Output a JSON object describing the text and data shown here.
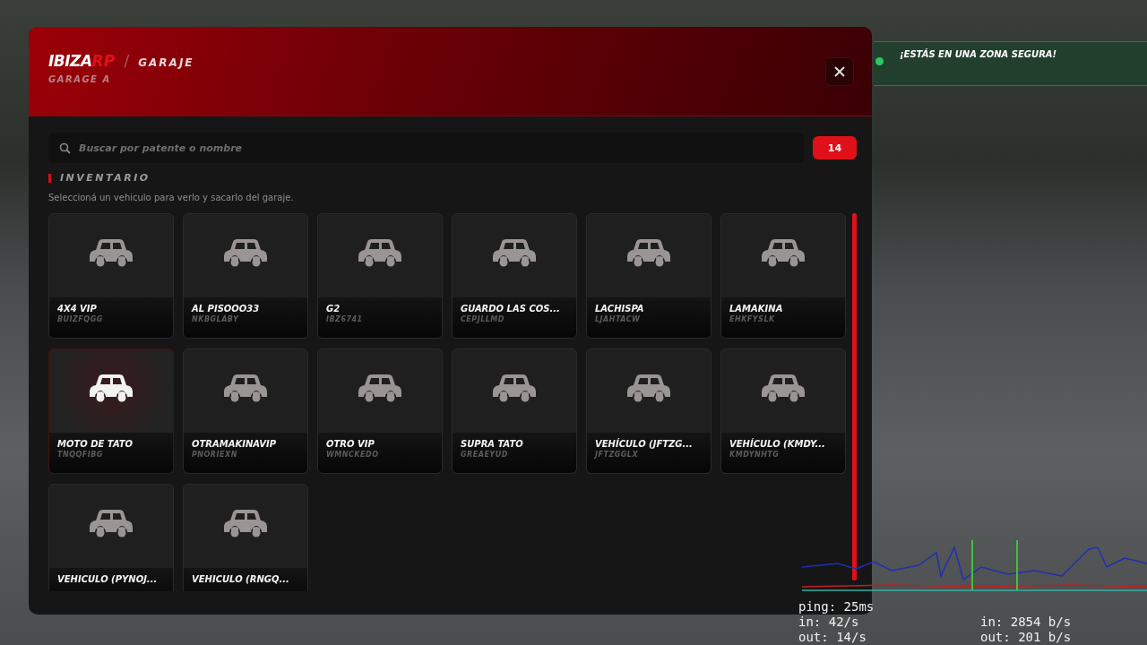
{
  "header": {
    "brand": "IBIZA",
    "brand_suffix": "RP",
    "separator": "/",
    "title": "GARAJE",
    "subtitle": "GARAGE A"
  },
  "search": {
    "placeholder": "Buscar por patente o nombre"
  },
  "count": "14",
  "section": {
    "title": "INVENTARIO",
    "hint": "Seleccioná un vehiculo para verlo y sacarlo del garaje."
  },
  "vehicles": [
    {
      "name": "4X4 VIP",
      "plate": "BUIZFQGG",
      "selected": false
    },
    {
      "name": "AL PISOOO33",
      "plate": "NKBGLABY",
      "selected": false
    },
    {
      "name": "G2",
      "plate": "IBZ6741",
      "selected": false
    },
    {
      "name": "GUARDO LAS COS...",
      "plate": "CEPJLLMD",
      "selected": false
    },
    {
      "name": "LACHISPA",
      "plate": "LJAHTACW",
      "selected": false
    },
    {
      "name": "LAMAKINA",
      "plate": "EHKFYSLK",
      "selected": false
    },
    {
      "name": "MOTO DE TATO",
      "plate": "TNQQFIBG",
      "selected": true
    },
    {
      "name": "OTRAMAKINAVIP",
      "plate": "PNORIEXN",
      "selected": false
    },
    {
      "name": "OTRO VIP",
      "plate": "WMNCKEDO",
      "selected": false
    },
    {
      "name": "SUPRA TATO",
      "plate": "GREAEYUD",
      "selected": false
    },
    {
      "name": "VEHÍCULO (JFTZG...",
      "plate": "JFTZGGLX",
      "selected": false
    },
    {
      "name": "VEHÍCULO (KMDY...",
      "plate": "KMDYNHTG",
      "selected": false
    },
    {
      "name": "VEHICULO (PYNOJ...",
      "selected": false
    },
    {
      "name": "VEHICULO (RNGQ...",
      "selected": false
    }
  ],
  "hud": {
    "notice": "¡ESTÁS EN UNA ZONA SEGURA!"
  },
  "net_stats": {
    "ping": "ping: 25ms",
    "in": "in: 42/s",
    "out": "out: 14/s",
    "bytes_in": "in: 2854 b/s",
    "bytes_out": "out: 201 b/s"
  }
}
